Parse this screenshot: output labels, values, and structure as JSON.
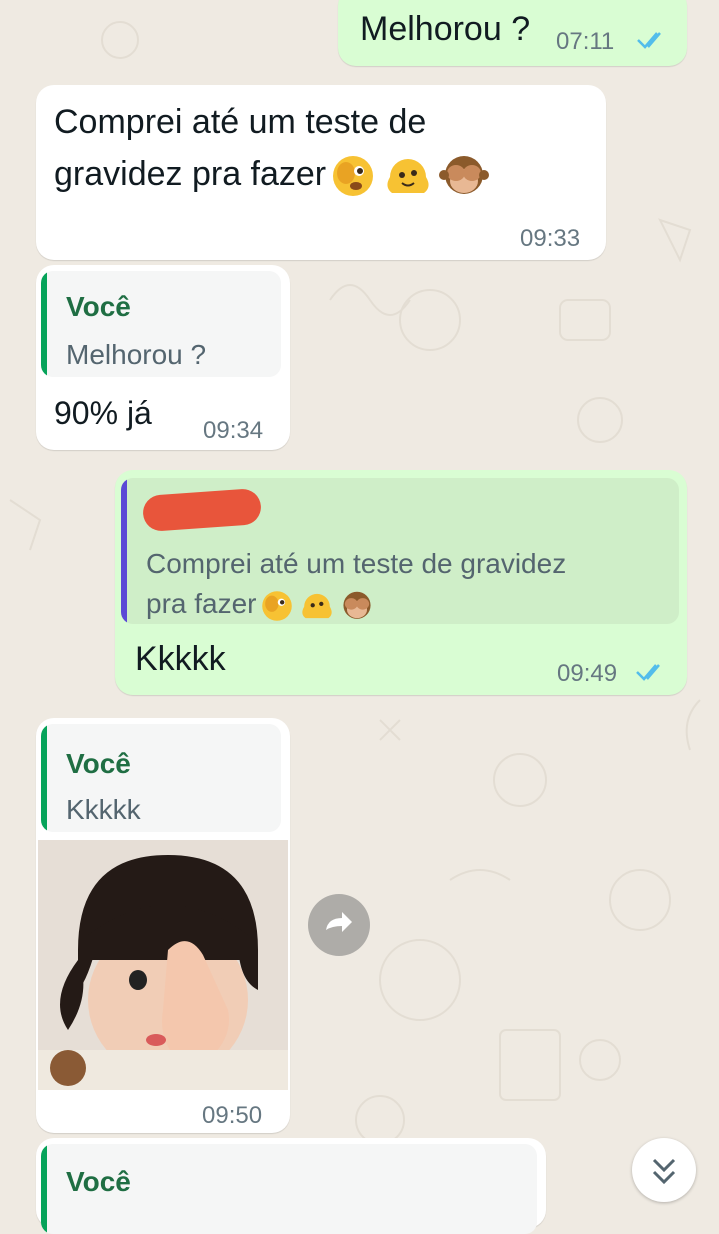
{
  "messages": {
    "m1": {
      "text": "Melhorou ?",
      "time": "07:11"
    },
    "m2": {
      "line1": "Comprei até um teste de",
      "line2": "gravidez pra fazer",
      "time": "09:33"
    },
    "m3": {
      "quote_author": "Você",
      "quote_text": "Melhorou ?",
      "text": "90% já",
      "time": "09:34"
    },
    "m4": {
      "quote_line1": "Comprei até um teste de gravidez",
      "quote_line2": "pra fazer",
      "text": "Kkkkk",
      "time": "09:49"
    },
    "m5": {
      "quote_author": "Você",
      "quote_text": "Kkkkk",
      "time": "09:50"
    },
    "m6": {
      "quote_author": "Você"
    }
  },
  "icons": {
    "read_receipt": "double-check-icon",
    "forward": "forward-icon",
    "scroll_down": "chevron-double-down-icon"
  },
  "colors": {
    "incoming_bubble": "#ffffff",
    "outgoing_bubble": "#d9fdd3",
    "read_tick": "#53bdeb",
    "quote_bar_you": "#06a35a",
    "quote_bar_other": "#5b49d6",
    "quote_author_you": "#1f6e43"
  }
}
